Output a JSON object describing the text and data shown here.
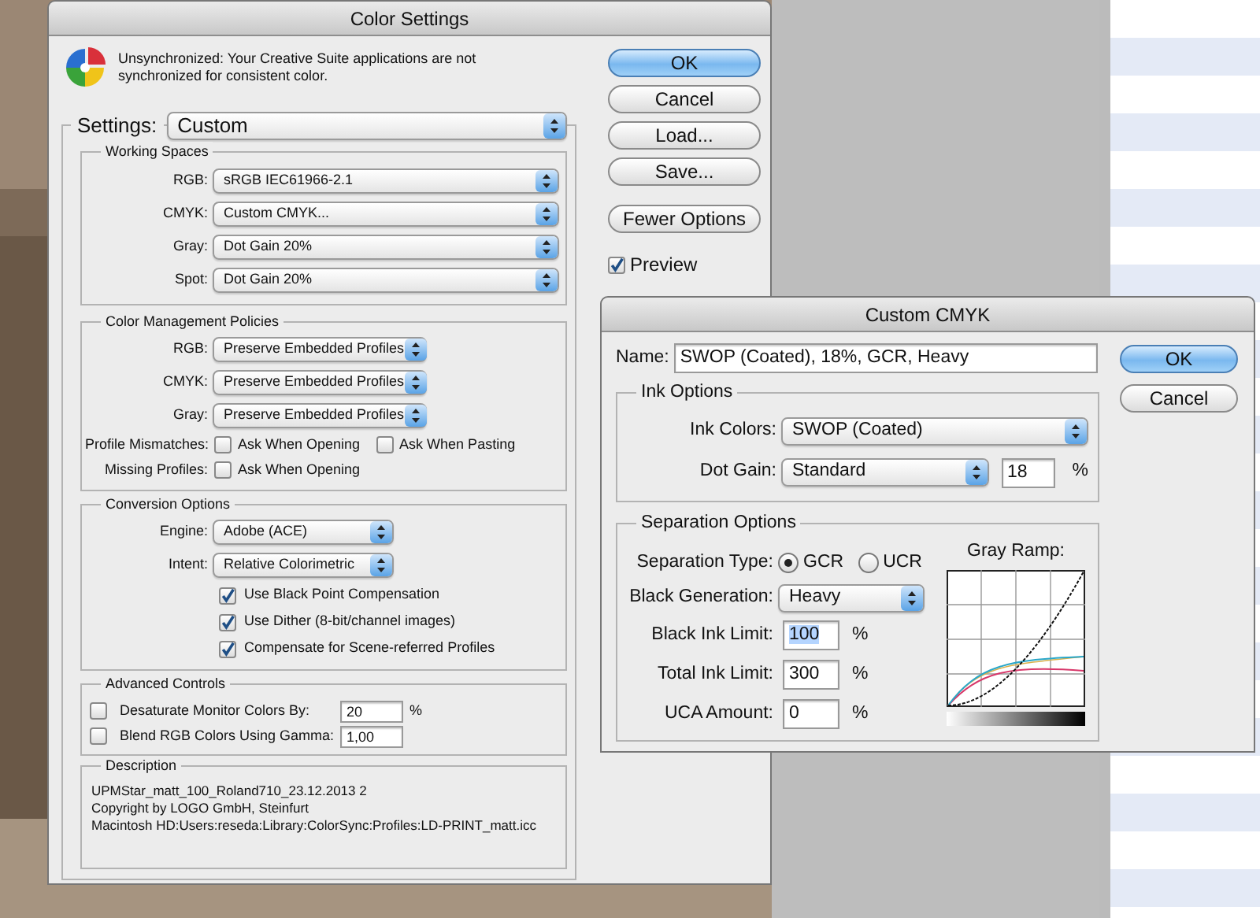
{
  "color_settings": {
    "title": "Color Settings",
    "message": "Unsynchronized: Your Creative Suite applications are not synchronized for consistent color.",
    "settings": {
      "label": "Settings:",
      "value": "Custom"
    },
    "working_spaces": {
      "title": "Working Spaces",
      "fields": [
        {
          "label": "RGB:",
          "value": "sRGB IEC61966-2.1"
        },
        {
          "label": "CMYK:",
          "value": "Custom CMYK..."
        },
        {
          "label": "Gray:",
          "value": "Dot Gain 20%"
        },
        {
          "label": "Spot:",
          "value": "Dot Gain 20%"
        }
      ]
    },
    "policies": {
      "title": "Color Management Policies",
      "fields": [
        {
          "label": "RGB:",
          "value": "Preserve Embedded Profiles"
        },
        {
          "label": "CMYK:",
          "value": "Preserve Embedded Profiles"
        },
        {
          "label": "Gray:",
          "value": "Preserve Embedded Profiles"
        }
      ],
      "checks": [
        {
          "label": "Profile Mismatches:",
          "options": [
            {
              "label": "Ask When Opening",
              "checked": false
            },
            {
              "label": "Ask When Pasting",
              "checked": false
            }
          ]
        },
        {
          "label": "Missing Profiles:",
          "options": [
            {
              "label": "Ask When Opening",
              "checked": false
            }
          ]
        }
      ]
    },
    "conversion": {
      "title": "Conversion Options",
      "fields": [
        {
          "label": "Engine:",
          "value": "Adobe (ACE)"
        },
        {
          "label": "Intent:",
          "value": "Relative Colorimetric"
        }
      ],
      "options": [
        {
          "label": "Use Black Point Compensation",
          "checked": true
        },
        {
          "label": "Use Dither (8-bit/channel images)",
          "checked": true
        },
        {
          "label": "Compensate for Scene-referred Profiles",
          "checked": true
        }
      ]
    },
    "advanced": {
      "title": "Advanced Controls",
      "rows": [
        {
          "label": "Desaturate Monitor Colors By:",
          "checked": false,
          "value": "20",
          "unit": "%"
        },
        {
          "label": "Blend RGB Colors Using Gamma:",
          "checked": false,
          "value": "1,00"
        }
      ]
    },
    "description": {
      "title": "Description",
      "lines": [
        "UPMStar_matt_100_Roland710_23.12.2013 2",
        "Copyright by LOGO GmbH, Steinfurt",
        "Macintosh HD:Users:reseda:Library:ColorSync:Profiles:LD-PRINT_matt.icc"
      ]
    },
    "buttons": [
      {
        "label": "OK",
        "default": true
      },
      {
        "label": "Cancel",
        "default": false
      },
      {
        "label": "Load...",
        "default": false
      },
      {
        "label": "Save...",
        "default": false
      }
    ],
    "options_button": {
      "label": "Fewer Options"
    },
    "preview": {
      "label": "Preview",
      "checked": true
    }
  },
  "custom_cmyk": {
    "title": "Custom CMYK",
    "name": {
      "label": "Name:",
      "value": "SWOP (Coated), 18%, GCR, Heavy"
    },
    "buttons": [
      {
        "label": "OK",
        "default": true
      },
      {
        "label": "Cancel",
        "default": false
      }
    ],
    "ink_options": {
      "title": "Ink Options",
      "ink_colors": {
        "label": "Ink Colors:",
        "value": "SWOP (Coated)"
      },
      "dot_gain": {
        "label": "Dot Gain:",
        "value": "Standard",
        "amount": "18",
        "unit": "%"
      }
    },
    "separation": {
      "title": "Separation Options",
      "type": {
        "label": "Separation Type:",
        "options": [
          {
            "label": "GCR",
            "selected": true
          },
          {
            "label": "UCR",
            "selected": false
          }
        ]
      },
      "black_generation": {
        "label": "Black Generation:",
        "value": "Heavy"
      },
      "limits": [
        {
          "label": "Black Ink Limit:",
          "value": "100",
          "unit": "%",
          "selected": true
        },
        {
          "label": "Total Ink Limit:",
          "value": "300",
          "unit": "%",
          "selected": false
        },
        {
          "label": "UCA Amount:",
          "value": "0",
          "unit": "%",
          "selected": false
        }
      ],
      "gray_ramp": {
        "title": "Gray Ramp:"
      }
    }
  }
}
